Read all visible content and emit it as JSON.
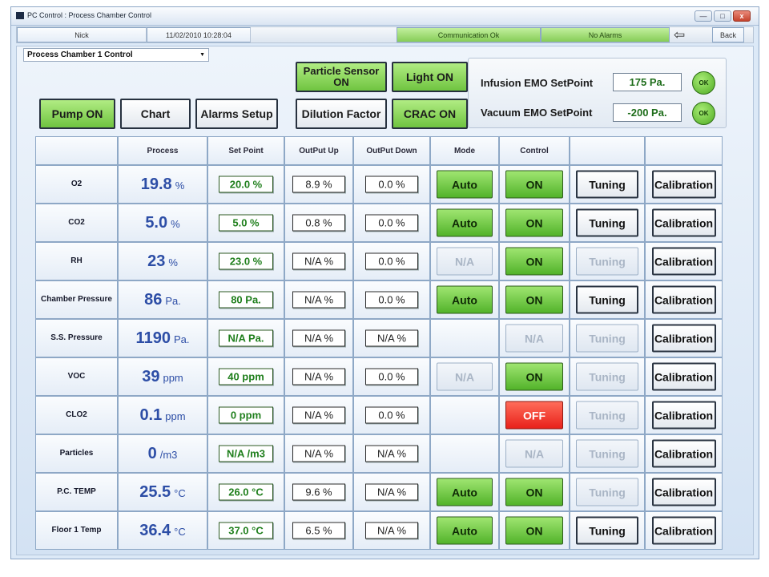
{
  "window": {
    "title": "PC Control : Process Chamber Control",
    "min_glyph": "—",
    "max_glyph": "□",
    "close_glyph": "x"
  },
  "status": {
    "user": "Nick",
    "datetime": "11/02/2010  10:28:04",
    "communication": "Communication Ok",
    "alarms": "No Alarms",
    "back_icon": "back-arrow-icon",
    "back_glyph": "⇦",
    "back_label": "Back"
  },
  "chamber_select": {
    "value": "Process Chamber 1 Control",
    "caret": "▼"
  },
  "buttons": {
    "pump": "Pump ON",
    "chart": "Chart",
    "alarms_setup": "Alarms Setup",
    "particle_sensor": "Particle Sensor ON",
    "dilution": "Dilution Factor",
    "light": "Light ON",
    "crac": "CRAC ON"
  },
  "emo": {
    "infusion_label": "Infusion EMO SetPoint",
    "infusion_value": "175 Pa.",
    "infusion_ok": "OK",
    "vacuum_label": "Vacuum EMO SetPoint",
    "vacuum_value": "-200 Pa.",
    "vacuum_ok": "OK"
  },
  "table": {
    "headers": [
      "",
      "Process",
      "Set Point",
      "OutPut Up",
      "OutPut Down",
      "Mode",
      "Control",
      "",
      ""
    ],
    "rows": [
      {
        "label": "O2",
        "process": "19.8",
        "unit": "%",
        "setpoint": "20.0 %",
        "out_up": "8.9 %",
        "out_down": "0.0 %",
        "mode": "Auto",
        "control": "ON",
        "tuning": "Tuning",
        "calibration": "Calibration"
      },
      {
        "label": "CO2",
        "process": "5.0",
        "unit": "%",
        "setpoint": "5.0 %",
        "out_up": "0.8 %",
        "out_down": "0.0 %",
        "mode": "Auto",
        "control": "ON",
        "tuning": "Tuning",
        "calibration": "Calibration"
      },
      {
        "label": "RH",
        "process": "23",
        "unit": "%",
        "setpoint": "23.0 %",
        "out_up": "N/A %",
        "out_down": "0.0 %",
        "mode": "N/A",
        "control": "ON",
        "tuning": "Tuning",
        "calibration": "Calibration"
      },
      {
        "label": "Chamber Pressure",
        "process": "86",
        "unit": "Pa.",
        "setpoint": "80  Pa.",
        "out_up": "N/A %",
        "out_down": "0.0 %",
        "mode": "Auto",
        "control": "ON",
        "tuning": "Tuning",
        "calibration": "Calibration"
      },
      {
        "label": "S.S. Pressure",
        "process": "1190",
        "unit": "Pa.",
        "setpoint": "N/A Pa.",
        "out_up": "N/A %",
        "out_down": "N/A %",
        "mode": "",
        "control": "N/A",
        "tuning": "Tuning",
        "calibration": "Calibration"
      },
      {
        "label": "VOC",
        "process": "39",
        "unit": "ppm",
        "setpoint": "40 ppm",
        "out_up": "N/A %",
        "out_down": "0.0 %",
        "mode": "N/A",
        "control": "ON",
        "tuning": "Tuning",
        "calibration": "Calibration"
      },
      {
        "label": "CLO2",
        "process": "0.1",
        "unit": "ppm",
        "setpoint": "0 ppm",
        "out_up": "N/A %",
        "out_down": "0.0 %",
        "mode": "",
        "control": "OFF",
        "tuning": "Tuning",
        "calibration": "Calibration"
      },
      {
        "label": "Particles",
        "process": "0",
        "unit": "/m3",
        "setpoint": "N/A  /m3",
        "out_up": "N/A %",
        "out_down": "N/A %",
        "mode": "",
        "control": "N/A",
        "tuning": "Tuning",
        "calibration": "Calibration"
      },
      {
        "label": "P.C. TEMP",
        "process": "25.5",
        "unit": "°C",
        "setpoint": "26.0 °C",
        "out_up": "9.6 %",
        "out_down": "N/A %",
        "mode": "Auto",
        "control": "ON",
        "tuning": "Tuning",
        "calibration": "Calibration"
      },
      {
        "label": "Floor 1 Temp",
        "process": "36.4",
        "unit": "°C",
        "setpoint": "37.0 °C",
        "out_up": "6.5 %",
        "out_down": "N/A %",
        "mode": "Auto",
        "control": "ON",
        "tuning": "Tuning",
        "calibration": "Calibration"
      }
    ]
  },
  "colors": {
    "accent_green": "#6fc440",
    "alarm_red": "#e8211a",
    "process_blue": "#2d4ea6",
    "setpoint_green": "#1f7f1c"
  }
}
